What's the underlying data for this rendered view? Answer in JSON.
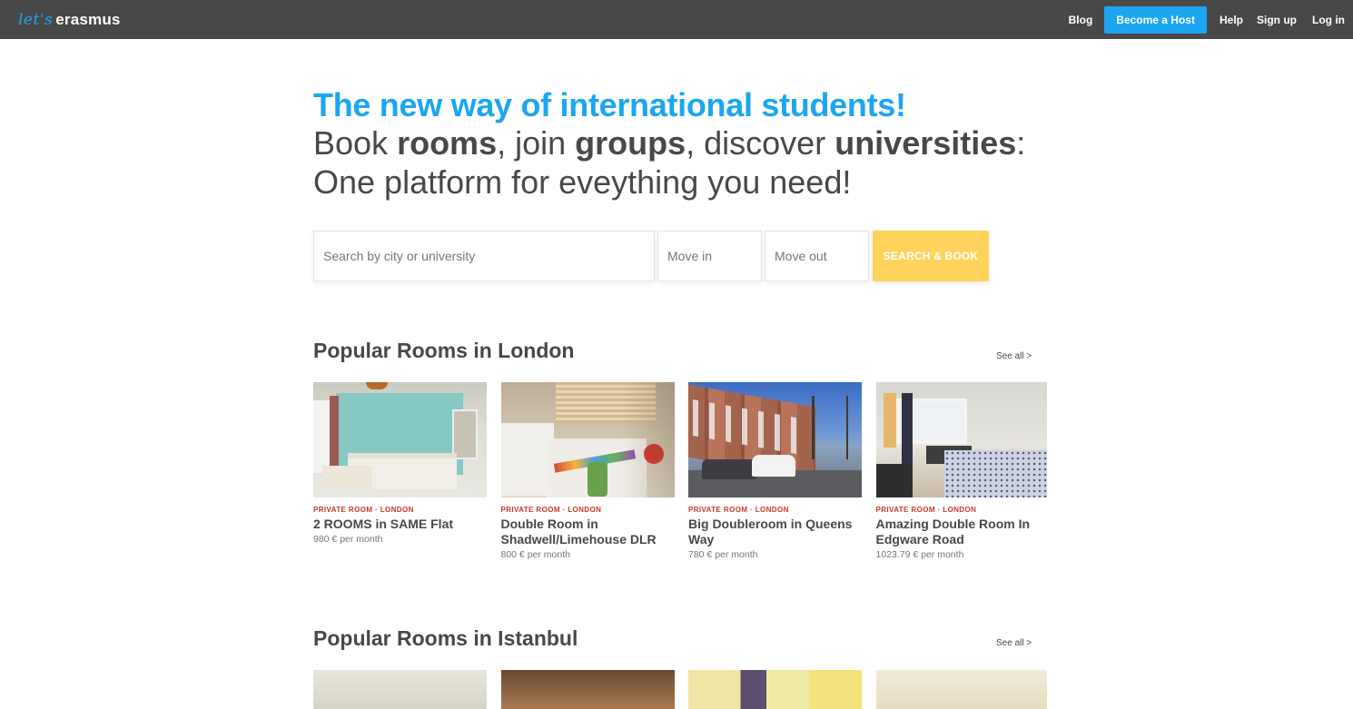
{
  "header": {
    "logo_script": "let's",
    "logo_word": "erasmus",
    "nav": {
      "blog": "Blog",
      "become_host": "Become a Host",
      "help": "Help",
      "signup": "Sign up",
      "login": "Log in"
    }
  },
  "hero": {
    "headline": "The new way of international students!",
    "line2_parts": [
      "Book ",
      "rooms",
      ", join ",
      "groups",
      ", discover ",
      "universities",
      ":"
    ],
    "line3": "One platform for eveything you need!"
  },
  "search": {
    "location_placeholder": "Search by city or university",
    "move_in_placeholder": "Move in",
    "move_out_placeholder": "Move out",
    "button_label": "SEARCH & BOOK"
  },
  "sections": [
    {
      "title": "Popular Rooms in London",
      "see_all": "See all >",
      "listings": [
        {
          "tag": "PRIVATE ROOM · LONDON",
          "title": "2 ROOMS in SAME Flat",
          "price": "980 € per month"
        },
        {
          "tag": "PRIVATE ROOM · LONDON",
          "title": "Double Room in Shadwell/Limehouse DLR",
          "price": "800 € per month"
        },
        {
          "tag": "PRIVATE ROOM · LONDON",
          "title": "Big Doubleroom in Queens Way",
          "price": "780 € per month"
        },
        {
          "tag": "PRIVATE ROOM · LONDON",
          "title": "Amazing Double Room In Edgware Road",
          "price": "1023.79 € per month"
        }
      ]
    },
    {
      "title": "Popular Rooms in Istanbul",
      "see_all": "See all >"
    }
  ],
  "colors": {
    "header_bg": "#484848",
    "accent_blue": "#1ba6f2",
    "search_button": "#ffd35c",
    "tag_red": "#c8382d",
    "text": "#484848"
  }
}
